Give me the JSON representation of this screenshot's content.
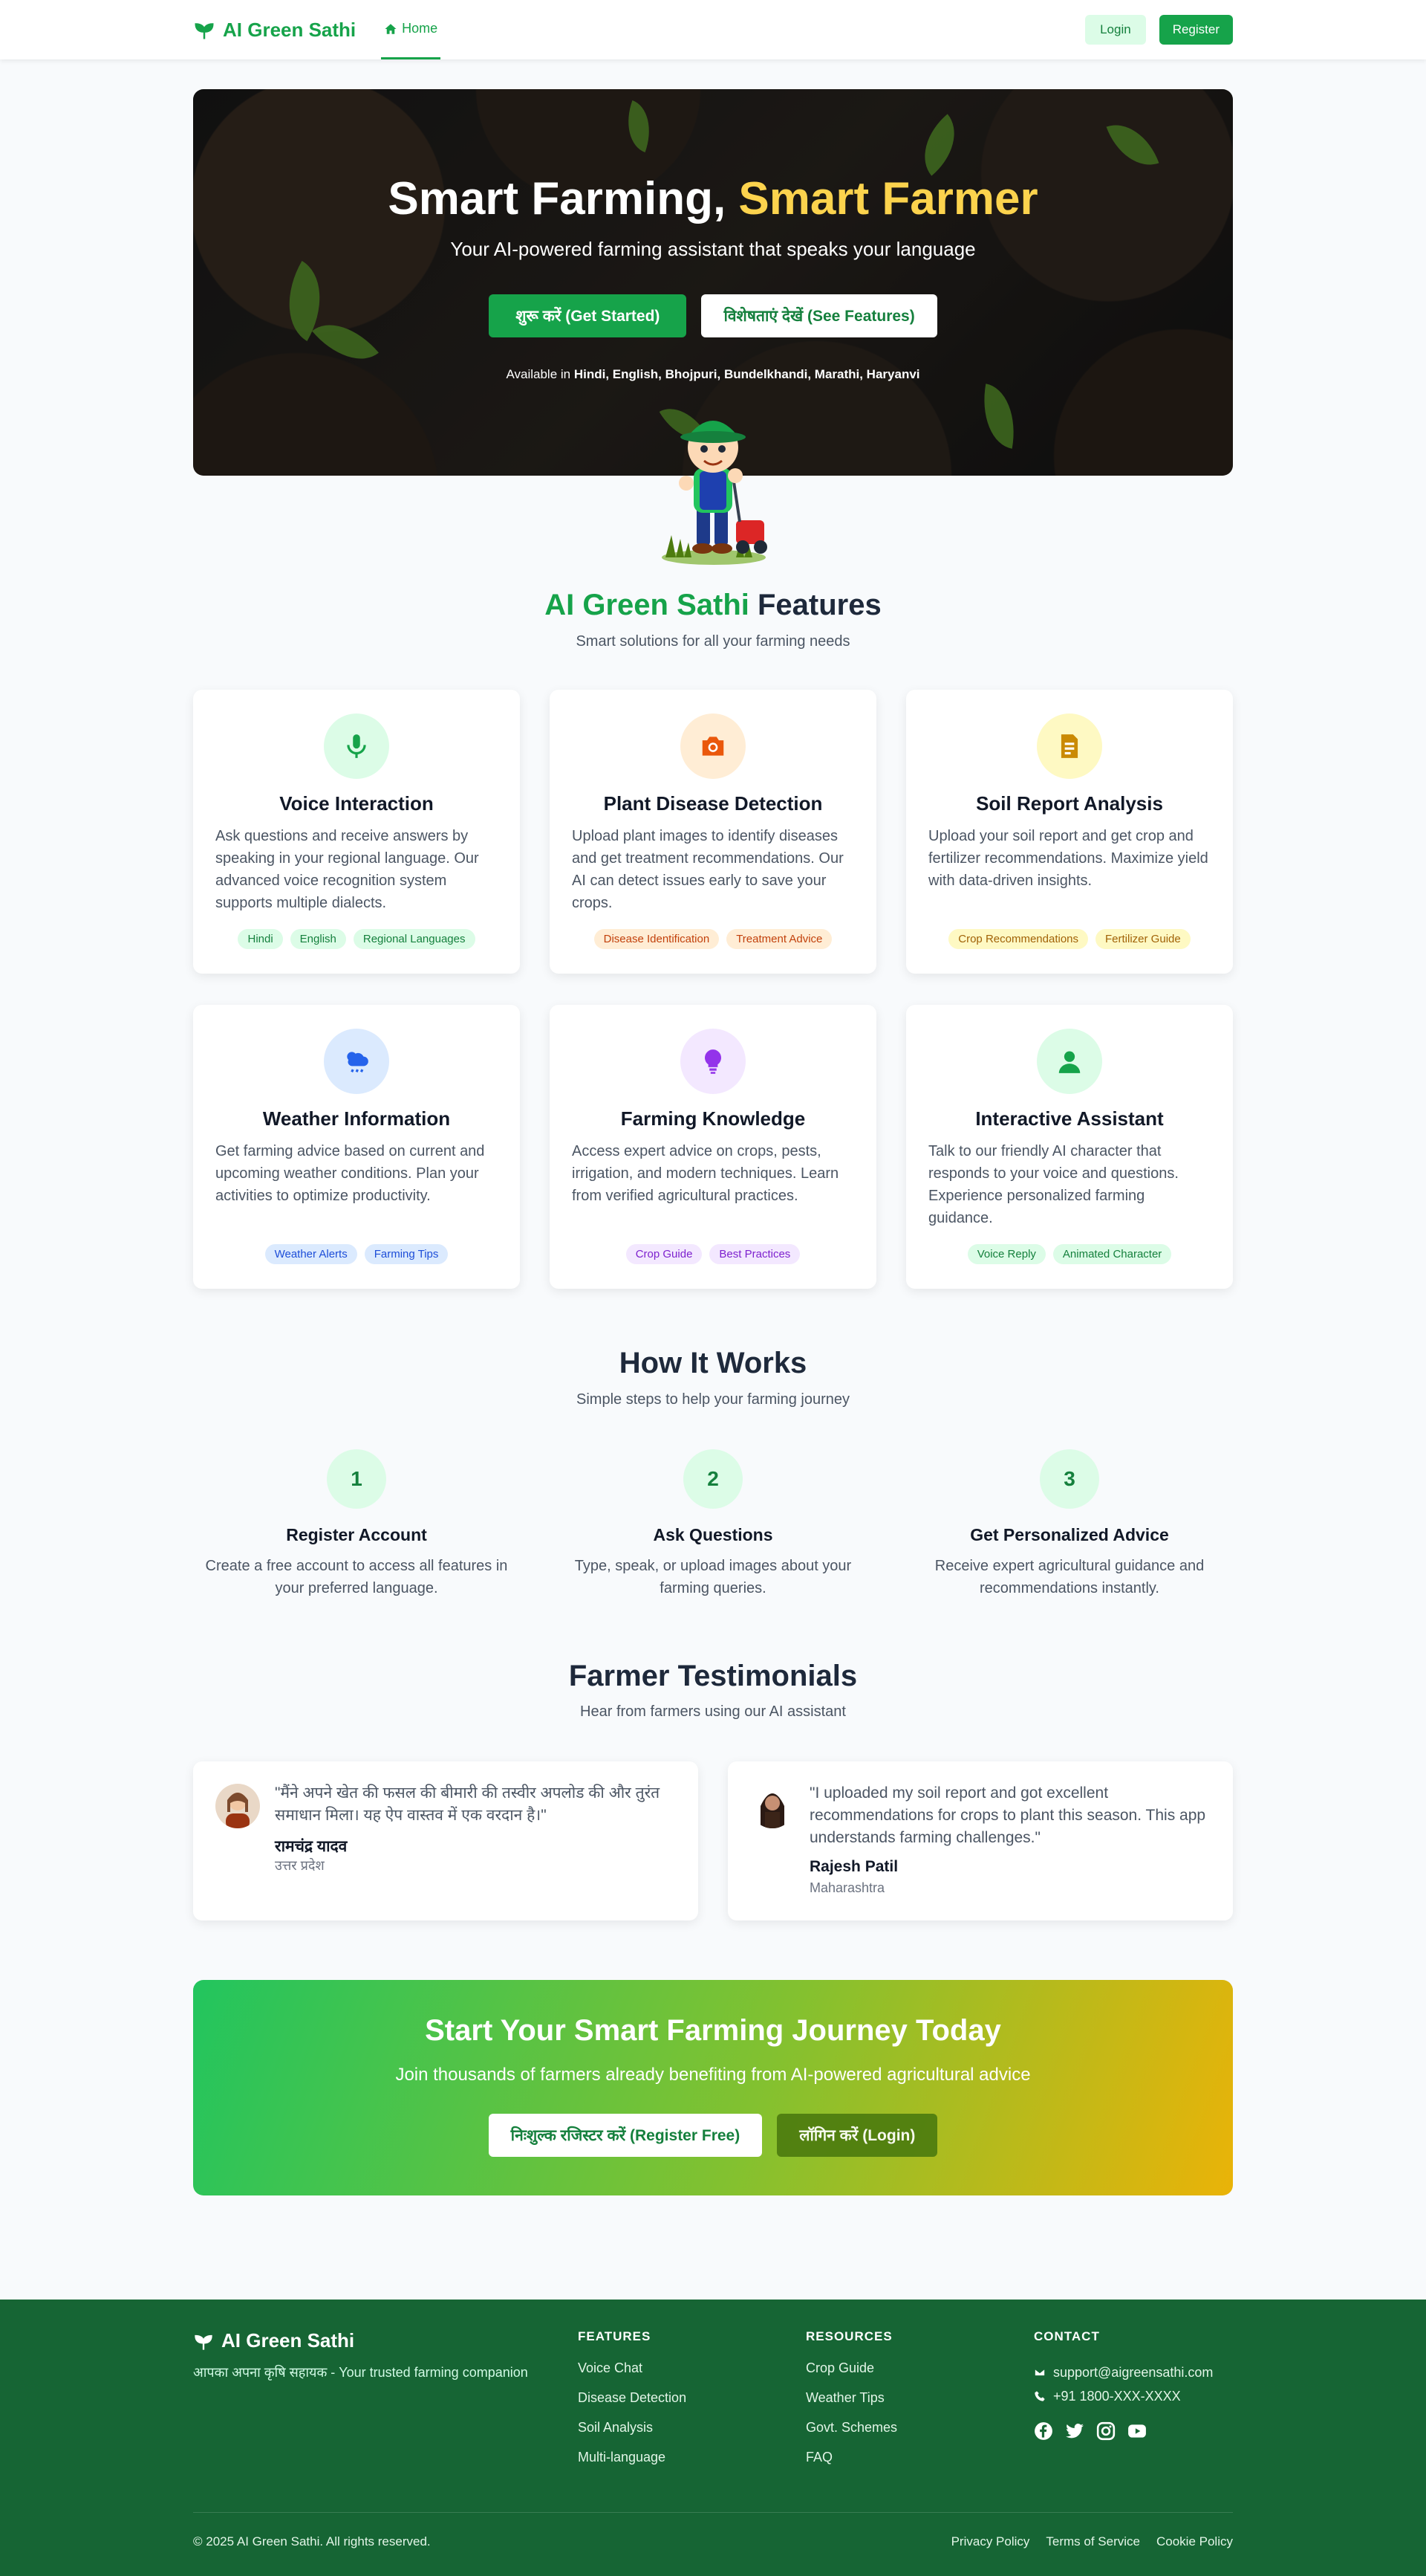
{
  "nav": {
    "brand": "AI Green Sathi",
    "home": "Home",
    "login": "Login",
    "register": "Register"
  },
  "hero": {
    "title_part1": "Smart Farming, ",
    "title_part2": "Smart Farmer",
    "subtitle": "Your AI-powered farming assistant that speaks your language",
    "cta_primary": "शुरू करें (Get Started)",
    "cta_secondary": "विशेषताएं देखें (See Features)",
    "available_prefix": "Available in ",
    "available_languages": "Hindi, English, Bhojpuri, Bundelkhandi, Marathi, Haryanvi"
  },
  "features": {
    "title_green": "AI Green Sathi",
    "title_rest": " Features",
    "subtitle": "Smart solutions for all your farming needs",
    "cards": [
      {
        "title": "Voice Interaction",
        "desc": "Ask questions and receive answers by speaking in your regional language. Our advanced voice recognition system supports multiple dialects.",
        "tags": [
          "Hindi",
          "English",
          "Regional Languages"
        ],
        "icon": "microphone-icon",
        "color": "#16a34a"
      },
      {
        "title": "Plant Disease Detection",
        "desc": "Upload plant images to identify diseases and get treatment recommendations. Our AI can detect issues early to save your crops.",
        "tags": [
          "Disease Identification",
          "Treatment Advice"
        ],
        "icon": "camera-icon",
        "color": "#ea580c"
      },
      {
        "title": "Soil Report Analysis",
        "desc": "Upload your soil report and get crop and fertilizer recommendations. Maximize yield with data-driven insights.",
        "tags": [
          "Crop Recommendations",
          "Fertilizer Guide"
        ],
        "icon": "document-icon",
        "color": "#ca8a04"
      },
      {
        "title": "Weather Information",
        "desc": "Get farming advice based on current and upcoming weather conditions. Plan your activities to optimize productivity.",
        "tags": [
          "Weather Alerts",
          "Farming Tips"
        ],
        "icon": "weather-icon",
        "color": "#2563eb"
      },
      {
        "title": "Farming Knowledge",
        "desc": "Access expert advice on crops, pests, irrigation, and modern techniques. Learn from verified agricultural practices.",
        "tags": [
          "Crop Guide",
          "Best Practices"
        ],
        "icon": "lightbulb-icon",
        "color": "#9333ea"
      },
      {
        "title": "Interactive Assistant",
        "desc": "Talk to our friendly AI character that responds to your voice and questions. Experience personalized farming guidance.",
        "tags": [
          "Voice Reply",
          "Animated Character"
        ],
        "icon": "user-icon",
        "color": "#16a34a"
      }
    ]
  },
  "how": {
    "title": "How It Works",
    "subtitle": "Simple steps to help your farming journey",
    "steps": [
      {
        "num": "1",
        "title": "Register Account",
        "desc": "Create a free account to access all features in your preferred language."
      },
      {
        "num": "2",
        "title": "Ask Questions",
        "desc": "Type, speak, or upload images about your farming queries."
      },
      {
        "num": "3",
        "title": "Get Personalized Advice",
        "desc": "Receive expert agricultural guidance and recommendations instantly."
      }
    ]
  },
  "testimonials": {
    "title": "Farmer Testimonials",
    "subtitle": "Hear from farmers using our AI assistant",
    "items": [
      {
        "quote": "\"मैंने अपने खेत की फसल की बीमारी की तस्वीर अपलोड की और तुरंत समाधान मिला। यह ऐप वास्तव में एक वरदान है।\"",
        "name": "रामचंद्र यादव",
        "place": "उत्तर प्रदेश"
      },
      {
        "quote": "\"I uploaded my soil report and got excellent recommendations for crops to plant this season. This app understands farming challenges.\"",
        "name": "Rajesh Patil",
        "place": "Maharashtra"
      }
    ]
  },
  "cta": {
    "title": "Start Your Smart Farming Journey Today",
    "subtitle": "Join thousands of farmers already benefiting from AI-powered agricultural advice",
    "register": "निःशुल्क रजिस्टर करें (Register Free)",
    "login": "लॉगिन करें (Login)"
  },
  "footer": {
    "brand": "AI Green Sathi",
    "tagline": "आपका अपना कृषि सहायक - Your trusted farming companion",
    "features_heading": "FEATURES",
    "features": [
      "Voice Chat",
      "Disease Detection",
      "Soil Analysis",
      "Multi-language"
    ],
    "resources_heading": "RESOURCES",
    "resources": [
      "Crop Guide",
      "Weather Tips",
      "Govt. Schemes",
      "FAQ"
    ],
    "contact_heading": "CONTACT",
    "email": "support@aigreensathi.com",
    "phone": "+91 1800-XXX-XXXX",
    "copyright": "© 2025 AI Green Sathi. All rights reserved.",
    "legal": [
      "Privacy Policy",
      "Terms of Service",
      "Cookie Policy"
    ]
  }
}
